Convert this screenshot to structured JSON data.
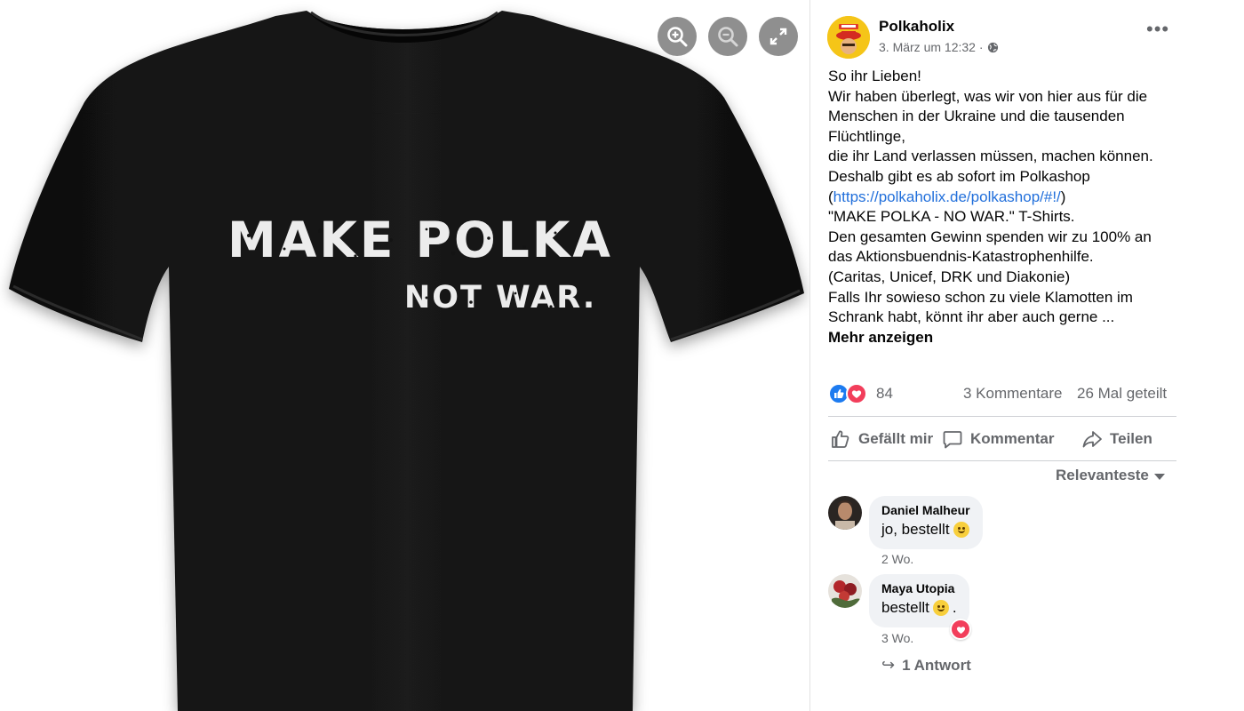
{
  "viewer": {
    "print_line1": "MAKE POLKA",
    "print_line2": "NOT WAR.",
    "zoom_in_icon": "zoom-in-icon",
    "zoom_out_icon": "zoom-out-icon",
    "fullscreen_icon": "fullscreen-icon"
  },
  "post": {
    "page_name": "Polkaholix",
    "date": "3. März um 12:32 ·",
    "privacy_icon": "globe-icon",
    "more_label": "•••",
    "lines": [
      {
        "text": "So ihr Lieben!"
      },
      {
        "text": "Wir haben überlegt, was wir von hier aus für die"
      },
      {
        "text": "Menschen in der Ukraine und die tausenden"
      },
      {
        "text": "Flüchtlinge,"
      },
      {
        "text": "die ihr Land verlassen müssen, machen können."
      },
      {
        "text": "Deshalb gibt es ab sofort im Polkashop"
      }
    ],
    "link_open": "(",
    "link_url": "https://polkaholix.de/polkashop/#!/",
    "link_close": ")",
    "lines_after": [
      {
        "text": "\"MAKE POLKA - NO WAR.\" T-Shirts."
      },
      {
        "text": "Den gesamten Gewinn spenden wir zu 100% an"
      },
      {
        "text": "das Aktionsbuendnis-Katastrophenhilfe."
      },
      {
        "text": "(Caritas, Unicef, DRK und Diakonie)"
      },
      {
        "text": "Falls Ihr sowieso schon zu viele Klamotten im"
      },
      {
        "text": "Schrank habt, könnt ihr aber auch gerne ..."
      }
    ],
    "see_more": "Mehr anzeigen"
  },
  "stats": {
    "reaction_count": "84",
    "comments": "3 Kommentare",
    "shares": "26 Mal geteilt"
  },
  "actions": {
    "like": "Gefällt mir",
    "comment": "Kommentar",
    "share": "Teilen"
  },
  "sort": {
    "label": "Relevanteste"
  },
  "comments": [
    {
      "author": "Daniel Malheur",
      "text": "jo, bestellt",
      "emoji": "wink-emoji",
      "time": "2 Wo."
    },
    {
      "author": "Maya Utopia",
      "text": "bestellt",
      "after_emoji": ".",
      "emoji": "smile-emoji",
      "time": "3 Wo.",
      "reaction": "love"
    }
  ],
  "reply": {
    "label": "1 Antwort"
  },
  "colors": {
    "link": "#216fdb",
    "secondary_text": "#65676b",
    "like_blue": "#1d7bf0",
    "love_red": "#f23e5b",
    "shirt": "#141414"
  }
}
